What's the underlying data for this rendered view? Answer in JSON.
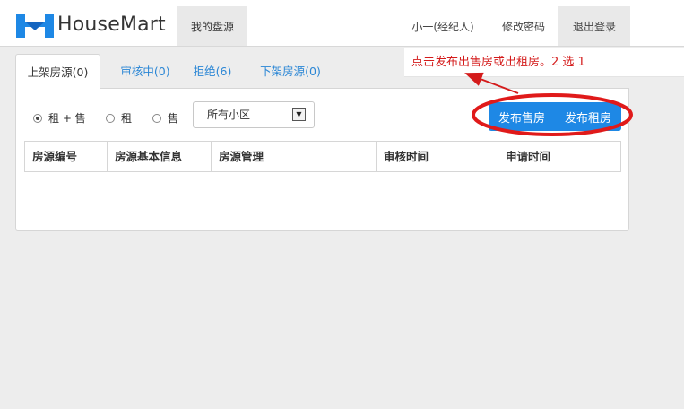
{
  "header": {
    "logo_text": "HouseMart",
    "nav_active": "我的盘源",
    "user": "小一(经纪人)",
    "change_password": "修改密码",
    "logout": "退出登录"
  },
  "tabs": [
    {
      "label": "上架房源(0)",
      "active": true
    },
    {
      "label": "审核中(0)",
      "active": false
    },
    {
      "label": "拒绝(6)",
      "active": false
    },
    {
      "label": "下架房源(0)",
      "active": false
    }
  ],
  "filters": {
    "radios": [
      {
        "label": "租 + 售",
        "checked": true
      },
      {
        "label": "租",
        "checked": false
      },
      {
        "label": "售",
        "checked": false
      }
    ],
    "community_select": "所有小区"
  },
  "actions": {
    "publish_sale": "发布售房",
    "publish_rent": "发布租房"
  },
  "table": {
    "columns": [
      "房源编号",
      "房源基本信息",
      "房源管理",
      "审核时间",
      "申请时间"
    ],
    "rows": []
  },
  "annotation": {
    "text": "点击发布出售房或出租房。2 选 1",
    "color": "#d41b1b"
  },
  "colors": {
    "accent": "#1e88e5",
    "link": "#2a86d5"
  }
}
